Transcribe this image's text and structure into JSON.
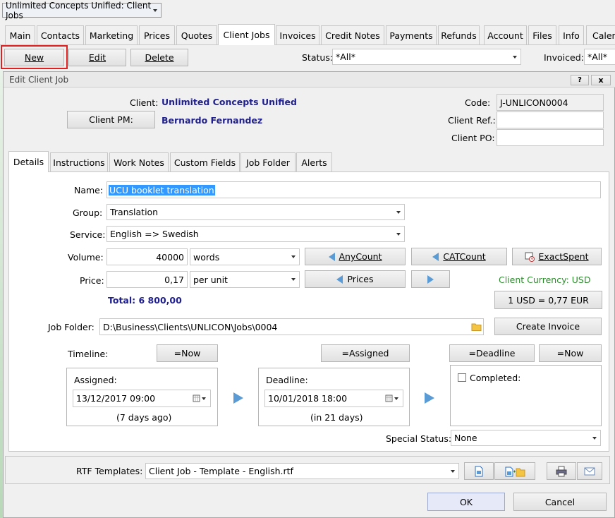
{
  "window": {
    "selector": "Unlimited Concepts Unified: Client Jobs"
  },
  "main_tabs": [
    {
      "label": "Main"
    },
    {
      "label": "Contacts"
    },
    {
      "label": "Marketing"
    },
    {
      "label": "Prices"
    },
    {
      "label": "Quotes"
    },
    {
      "label": "Client Jobs"
    },
    {
      "label": "Invoices"
    },
    {
      "label": "Credit Notes"
    },
    {
      "label": "Payments"
    },
    {
      "label": "Refunds"
    },
    {
      "label": "Account"
    },
    {
      "label": "Files"
    },
    {
      "label": "Info"
    },
    {
      "label": "Calen"
    }
  ],
  "toolbar": {
    "new": "New",
    "edit": "Edit",
    "delete": "Delete",
    "status_label": "Status:",
    "status_value": "*All*",
    "invoiced_label": "Invoiced:",
    "invoiced_value": "*All*"
  },
  "dialog": {
    "title": "Edit Client Job",
    "help": "?",
    "close": "x",
    "client_label": "Client:",
    "client_value": "Unlimited Concepts Unified",
    "client_pm_button": "Client PM:",
    "client_pm_value": "Bernardo Fernandez",
    "code_label": "Code:",
    "code_value": "J-UNLICON0004",
    "client_ref_label": "Client Ref.:",
    "client_ref_value": "",
    "client_po_label": "Client PO:",
    "client_po_value": "",
    "tabs": [
      {
        "label": "Details"
      },
      {
        "label": "Instructions"
      },
      {
        "label": "Work Notes"
      },
      {
        "label": "Custom Fields"
      },
      {
        "label": "Job Folder"
      },
      {
        "label": "Alerts"
      }
    ],
    "details": {
      "name_label": "Name:",
      "name_value": "UCU booklet translation",
      "group_label": "Group:",
      "group_value": "Translation",
      "service_label": "Service:",
      "service_value": "English => Swedish",
      "volume_label": "Volume:",
      "volume_value": "40000",
      "volume_unit": "words",
      "anycount": "AnyCount",
      "catcount": "CATCount",
      "exactspent": "ExactSpent",
      "price_label": "Price:",
      "price_value": "0,17",
      "price_unit": "per unit",
      "prices_button": "Prices",
      "currency_label": "Client Currency: USD",
      "total": "Total: 6 800,00",
      "rate_button": "1 USD = 0,77 EUR",
      "job_folder_label": "Job Folder:",
      "job_folder_value": "D:\\Business\\Clients\\UNLICON\\Jobs\\0004",
      "create_invoice": "Create Invoice",
      "timeline_label": "Timeline:",
      "now_button_1": "=Now",
      "assigned_button": "=Assigned",
      "deadline_button": "=Deadline",
      "now_button_2": "=Now",
      "assigned_label": "Assigned:",
      "assigned_value": "13/12/2017 09:00",
      "assigned_ago": "(7 days ago)",
      "deadline_label": "Deadline:",
      "deadline_value": "10/01/2018 18:00",
      "deadline_in": "(in 21 days)",
      "completed_label": "Completed:",
      "special_status_label": "Special Status:",
      "special_status_value": "None"
    },
    "rtf_label": "RTF Templates:",
    "rtf_value": "Client Job - Template - English.rtf",
    "ok": "OK",
    "cancel": "Cancel"
  },
  "colors": {
    "accent_blue": "#1f1f8f",
    "highlight": "#3399ff",
    "green": "#2e8b2e",
    "red_outline": "#e02020"
  }
}
